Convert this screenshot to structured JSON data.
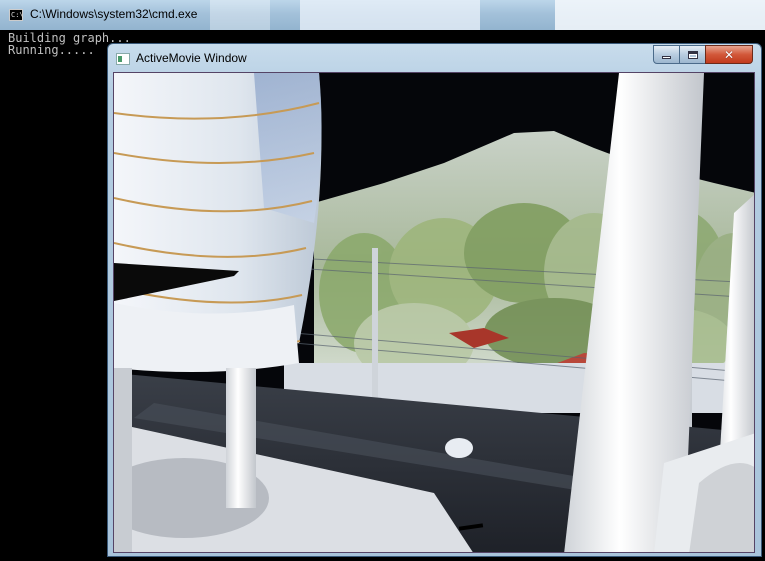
{
  "console": {
    "title": "C:\\Windows\\system32\\cmd.exe",
    "icon": "console-icon",
    "lines": [
      "Building graph...",
      "Running....."
    ]
  },
  "video_window": {
    "title": "ActiveMovie Window",
    "icon": "activemovie-icon",
    "buttons": {
      "minimize": "minimize-icon",
      "maximize": "maximize-icon",
      "close": "✕"
    }
  }
}
